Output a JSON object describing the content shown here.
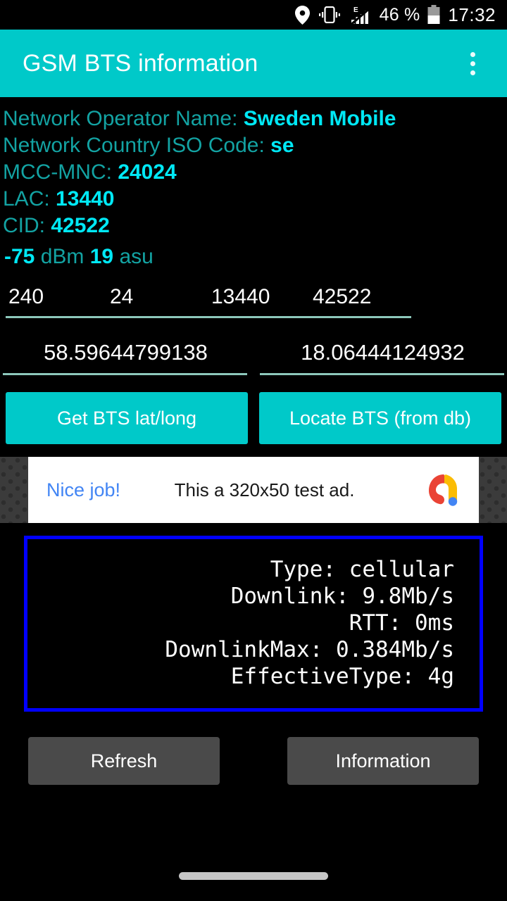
{
  "status_bar": {
    "icons": [
      "location-pin-icon",
      "vibrate-icon",
      "signal-edge-icon"
    ],
    "battery_percent": "46 %",
    "network_type_letter": "E",
    "time": "17:32"
  },
  "app_bar": {
    "title": "GSM BTS information",
    "overflow_menu": "overflow-menu-icon"
  },
  "info": {
    "lines": [
      {
        "label": "Network Operator Name: ",
        "value": "Sweden Mobile"
      },
      {
        "label": "Network Country ISO Code: ",
        "value": "se"
      },
      {
        "label": "MCC-MNC: ",
        "value": "24024"
      },
      {
        "label": "LAC: ",
        "value": "13440"
      },
      {
        "label": "CID: ",
        "value": "42522"
      }
    ],
    "signal": {
      "dbm_value": "-75",
      "dbm_unit": "dBm",
      "asu_value": "19",
      "asu_unit": "asu"
    }
  },
  "form": {
    "mcc": "240",
    "mnc": "24",
    "lac": "13440",
    "cid": "42522",
    "latitude": "58.59644799138",
    "longitude": "18.06444124932"
  },
  "actions": {
    "get_latlong": "Get BTS lat/long",
    "locate_bts": "Locate BTS (from db)",
    "refresh": "Refresh",
    "information": "Information"
  },
  "ad": {
    "cta": "Nice job!",
    "body": "This a 320x50 test ad.",
    "logo": "admob-logo-icon"
  },
  "network_box": {
    "lines": [
      "Type: cellular",
      "Downlink: 9.8Mb/s",
      "RTT: 0ms",
      "DownlinkMax: 0.384Mb/s",
      "EffectiveType: 4g"
    ],
    "border_color": "#0000ff"
  },
  "theme": {
    "accent": "#00c9c9",
    "label_teal": "#13a3a3",
    "value_cyan": "#00e8f5",
    "underline": "#8dc8bb",
    "gray_button": "#4a4a4a"
  }
}
